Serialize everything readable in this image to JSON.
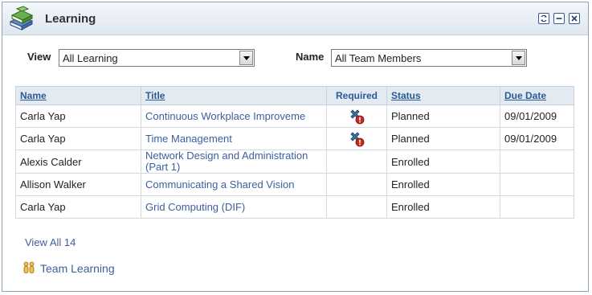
{
  "header": {
    "title": "Learning",
    "icons": [
      "books-icon",
      "refresh-icon",
      "minimize-icon",
      "close-icon"
    ]
  },
  "filters": {
    "view_label": "View",
    "view_value": "All Learning",
    "name_label": "Name",
    "name_value": "All Team Members"
  },
  "table": {
    "columns": [
      "Name",
      "Title",
      "Required",
      "Status",
      "Due Date"
    ],
    "rows": [
      {
        "name": "Carla Yap",
        "title": "Continuous Workplace Improveme",
        "required": true,
        "status": "Planned",
        "due": "09/01/2009"
      },
      {
        "name": "Carla Yap",
        "title": "Time Management",
        "required": true,
        "status": "Planned",
        "due": "09/01/2009"
      },
      {
        "name": "Alexis Calder",
        "title": "Network Design and Administration (Part 1)",
        "required": false,
        "status": "Enrolled",
        "due": ""
      },
      {
        "name": "Allison Walker",
        "title": "Communicating a Shared Vision",
        "required": false,
        "status": "Enrolled",
        "due": ""
      },
      {
        "name": "Carla Yap",
        "title": "Grid Computing (DIF)",
        "required": false,
        "status": "Enrolled",
        "due": ""
      }
    ]
  },
  "footer": {
    "view_all": "View All 14",
    "team_learning": "Team Learning"
  },
  "colors": {
    "link": "#3c5f9e",
    "header_bg": "#dfe6ef",
    "table_header_bg": "#e3eaf2"
  }
}
